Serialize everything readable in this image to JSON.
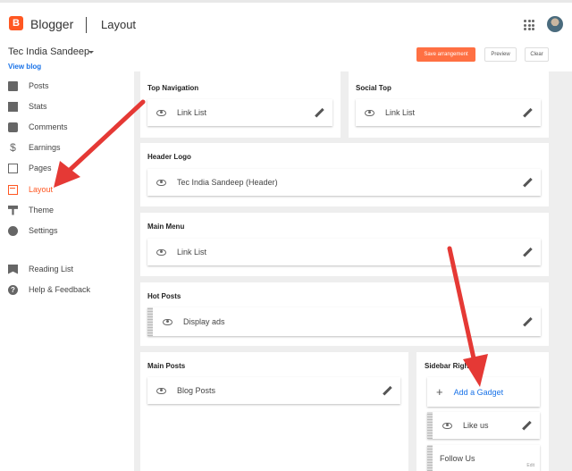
{
  "header": {
    "app_name": "Blogger",
    "page_name": "Layout",
    "icons": [
      "apps-grid-icon",
      "avatar"
    ]
  },
  "blog": {
    "name": "Tec India Sandeep",
    "view_blog": "View blog"
  },
  "toolbar": {
    "save_label": "Save arrangement",
    "preview_label": "Preview",
    "clear_label": "Clear"
  },
  "sidebar": {
    "items": [
      {
        "label": "Posts",
        "icon": "posts-icon"
      },
      {
        "label": "Stats",
        "icon": "stats-icon"
      },
      {
        "label": "Comments",
        "icon": "comments-icon"
      },
      {
        "label": "Earnings",
        "icon": "earnings-icon"
      },
      {
        "label": "Pages",
        "icon": "pages-icon"
      },
      {
        "label": "Layout",
        "icon": "layout-icon",
        "active": true
      },
      {
        "label": "Theme",
        "icon": "theme-icon"
      },
      {
        "label": "Settings",
        "icon": "settings-icon"
      },
      {
        "label": "Reading List",
        "icon": "reading-list-icon"
      },
      {
        "label": "Help & Feedback",
        "icon": "help-icon"
      }
    ]
  },
  "layout": {
    "sections": [
      {
        "title": "Top Navigation",
        "gadgets": [
          "Link List"
        ]
      },
      {
        "title": "Social Top",
        "gadgets": [
          "Link List"
        ]
      },
      {
        "title": "Header Logo",
        "gadgets": [
          "Tec India Sandeep (Header)"
        ]
      },
      {
        "title": "Main Menu",
        "gadgets": [
          "Link List"
        ]
      },
      {
        "title": "Hot Posts",
        "gadgets": [
          "Display ads"
        ]
      },
      {
        "title": "Main Posts",
        "gadgets": [
          "Blog Posts"
        ]
      },
      {
        "title": "Sidebar Right",
        "add_gadget": "Add a Gadget",
        "gadgets": [
          "Like us",
          "Follow Us"
        ],
        "edit_label": "Edit"
      }
    ]
  },
  "colors": {
    "accent": "#ff5722",
    "link": "#1a73e8",
    "arrow": "#e53935"
  }
}
